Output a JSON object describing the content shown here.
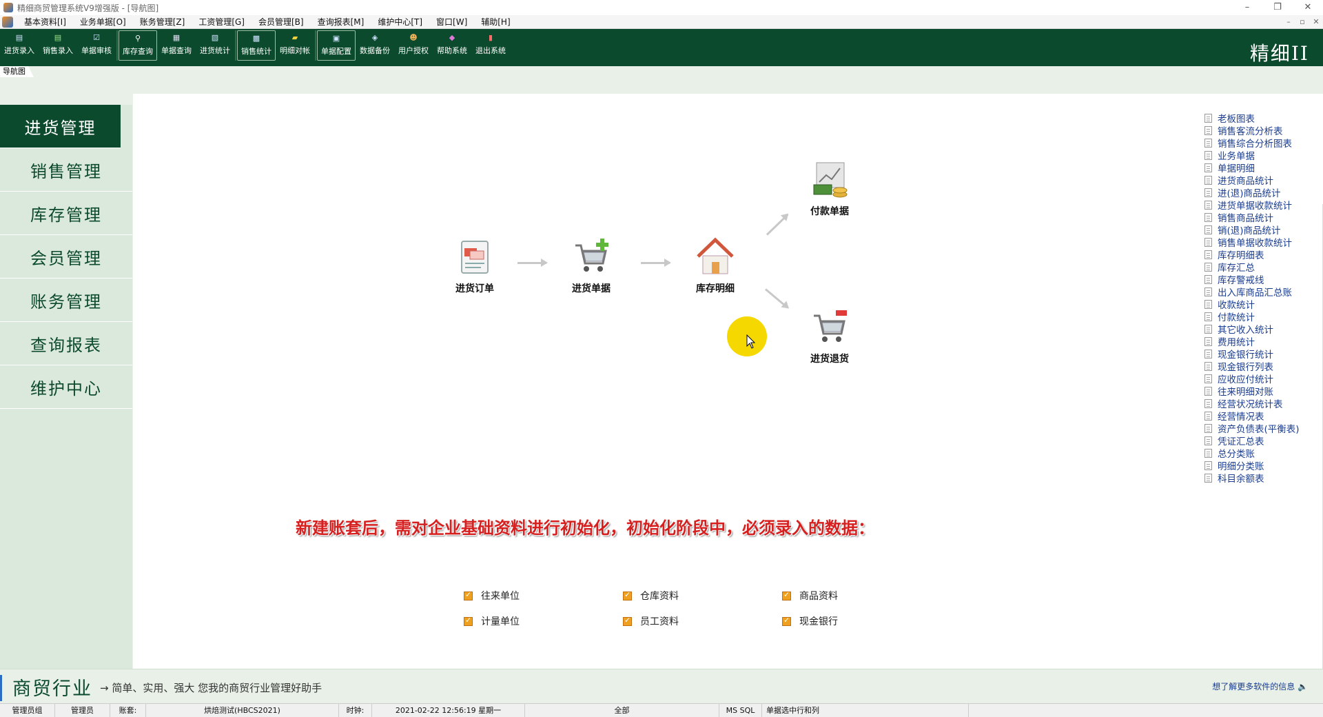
{
  "window": {
    "title": "精细商贸管理系统V9增强版 - [导航图]",
    "controls": [
      "–",
      "❐",
      "✕"
    ]
  },
  "menubar": {
    "items": [
      "基本资料[I]",
      "业务单据[O]",
      "账务管理[Z]",
      "工资管理[G]",
      "会员管理[B]",
      "查询报表[M]",
      "维护中心[T]",
      "窗口[W]",
      "辅助[H]"
    ],
    "mdi_controls": [
      "–",
      "▫",
      "✕"
    ]
  },
  "toolbar": {
    "items": [
      {
        "label": "进货录入",
        "icon": "purchase-entry-icon"
      },
      {
        "label": "销售录入",
        "icon": "sales-entry-icon"
      },
      {
        "label": "单据审核",
        "icon": "doc-audit-icon"
      },
      {
        "label": "库存查询",
        "icon": "stock-query-icon"
      },
      {
        "label": "单据查询",
        "icon": "doc-query-icon"
      },
      {
        "label": "进货统计",
        "icon": "purchase-stats-icon"
      },
      {
        "label": "销售统计",
        "icon": "sales-stats-icon"
      },
      {
        "label": "明细对帐",
        "icon": "detail-reconcile-icon"
      },
      {
        "label": "单据配置",
        "icon": "doc-config-icon"
      },
      {
        "label": "数据备份",
        "icon": "backup-icon"
      },
      {
        "label": "用户授权",
        "icon": "user-auth-icon"
      },
      {
        "label": "帮助系统",
        "icon": "help-icon"
      },
      {
        "label": "退出系统",
        "icon": "exit-icon"
      }
    ],
    "brand": "精细II"
  },
  "navtab": {
    "label": "导航图"
  },
  "sidebar": {
    "items": [
      "进货管理",
      "销售管理",
      "库存管理",
      "会员管理",
      "账务管理",
      "查询报表",
      "维护中心"
    ]
  },
  "flow": {
    "purchase_order": "进货订单",
    "purchase_doc": "进货单据",
    "stock_detail": "库存明细",
    "payment_doc": "付款单据",
    "purchase_return": "进货退货"
  },
  "notice": "新建账套后，需对企业基础资料进行初始化，初始化阶段中，必须录入的数据：",
  "required_data": [
    "往来单位",
    "仓库资料",
    "商品资料",
    "计量单位",
    "员工资料",
    "现金银行"
  ],
  "reports": [
    "老板图表",
    "销售客流分析表",
    "销售综合分析图表",
    "业务单据",
    "单据明细",
    "进货商品统计",
    "进(退)商品统计",
    "进货单据收款统计",
    "销售商品统计",
    "销(退)商品统计",
    "销售单据收款统计",
    "库存明细表",
    "库存汇总",
    "库存警戒线",
    "出入库商品汇总账",
    "收款统计",
    "付款统计",
    "其它收入统计",
    "费用统计",
    "现金银行统计",
    "现金银行列表",
    "应收应付统计",
    "往来明细对账",
    "经营状况统计表",
    "经营情况表",
    "资产负债表(平衡表)",
    "凭证汇总表",
    "总分类账",
    "明细分类账",
    "科目余额表"
  ],
  "footer": {
    "slogan_big": "商贸行业",
    "slogan_small": "→ 简单、实用、强大 您我的商贸行业管理好助手",
    "more_info": "想了解更多软件的信息 🔈"
  },
  "statusbar": {
    "group": "管理员组",
    "user": "管理员",
    "account_label": "账套:",
    "account": "烘焙测试(HBCS2021)",
    "clock_label": "时钟:",
    "clock": "2021-02-22 12:56:19  星期一",
    "scope": "全部",
    "db": "MS SQL",
    "hint": "单据选中行和列"
  },
  "colors": {
    "primary": "#0b4a2c",
    "notice": "#d62020",
    "link": "#1a3d8f",
    "highlight": "#f5d800"
  }
}
